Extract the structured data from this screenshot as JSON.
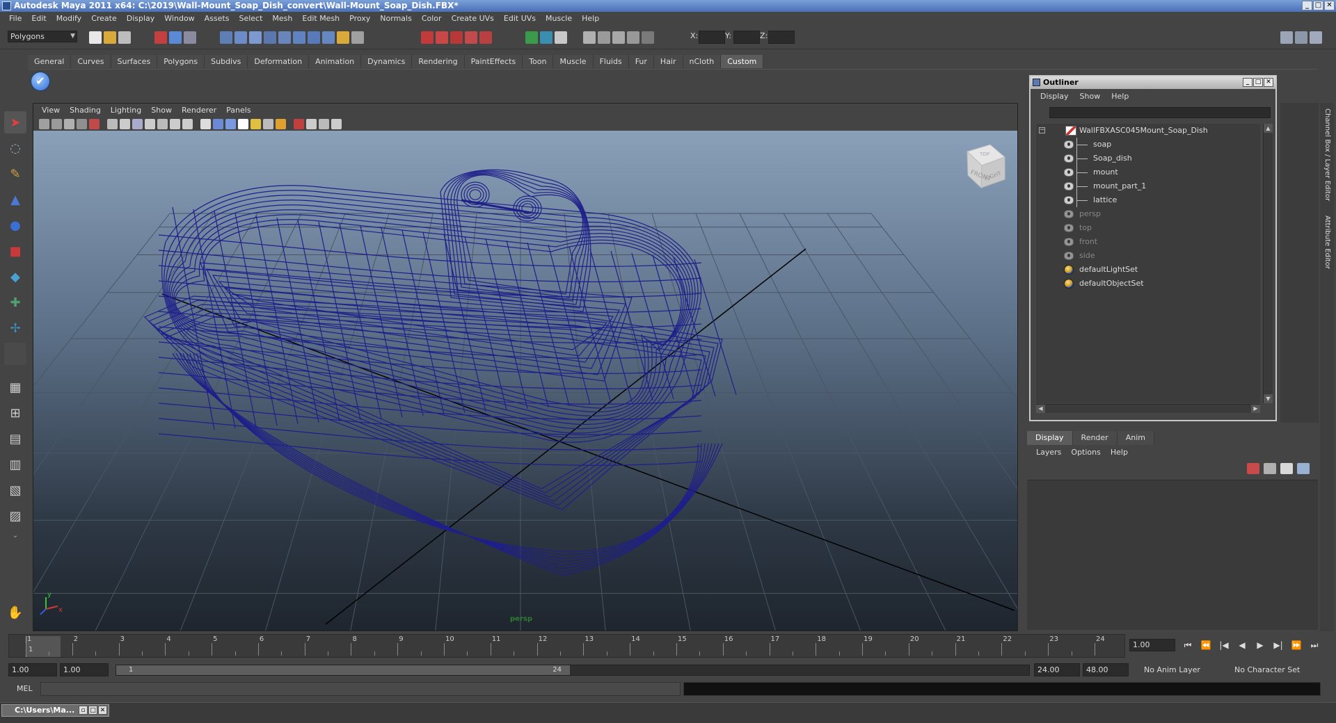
{
  "window": {
    "title": "Autodesk Maya 2011 x64: C:\\2019\\Wall-Mount_Soap_Dish_convert\\Wall-Mount_Soap_Dish.FBX*"
  },
  "menubar": [
    "File",
    "Edit",
    "Modify",
    "Create",
    "Display",
    "Window",
    "Assets",
    "Select",
    "Mesh",
    "Edit Mesh",
    "Proxy",
    "Normals",
    "Color",
    "Create UVs",
    "Edit UVs",
    "Muscle",
    "Help"
  ],
  "statusline": {
    "mode": "Polygons",
    "x_label": "X:",
    "y_label": "Y:",
    "z_label": "Z:"
  },
  "shelf": {
    "tabs": [
      "General",
      "Curves",
      "Surfaces",
      "Polygons",
      "Subdivs",
      "Deformation",
      "Animation",
      "Dynamics",
      "Rendering",
      "PaintEffects",
      "Toon",
      "Muscle",
      "Fluids",
      "Fur",
      "Hair",
      "nCloth",
      "Custom"
    ],
    "active": "Custom"
  },
  "viewport": {
    "menu": [
      "View",
      "Shading",
      "Lighting",
      "Show",
      "Renderer",
      "Panels"
    ],
    "camera_label": "persp",
    "viewcube": {
      "front": "FRONT",
      "right": "RIGHT",
      "top": "TOP"
    },
    "axis_x": "x",
    "axis_y": "y"
  },
  "outliner": {
    "title": "Outliner",
    "menu": [
      "Display",
      "Show",
      "Help"
    ],
    "items": [
      {
        "label": "WallFBXASC045Mount_Soap_Dish",
        "kind": "group",
        "dim": false
      },
      {
        "label": "soap",
        "kind": "child",
        "dim": false
      },
      {
        "label": "Soap_dish",
        "kind": "child",
        "dim": false
      },
      {
        "label": "mount",
        "kind": "child",
        "dim": false
      },
      {
        "label": "mount_part_1",
        "kind": "child",
        "dim": false
      },
      {
        "label": "lattice",
        "kind": "child",
        "dim": false
      },
      {
        "label": "persp",
        "kind": "camera",
        "dim": true
      },
      {
        "label": "top",
        "kind": "camera",
        "dim": true
      },
      {
        "label": "front",
        "kind": "camera",
        "dim": true
      },
      {
        "label": "side",
        "kind": "camera",
        "dim": true
      },
      {
        "label": "defaultLightSet",
        "kind": "set",
        "dim": false
      },
      {
        "label": "defaultObjectSet",
        "kind": "set",
        "dim": false
      }
    ]
  },
  "side_tabs": [
    "Channel Box / Layer Editor",
    "Attribute Editor"
  ],
  "layer_editor": {
    "tabs": [
      "Display",
      "Render",
      "Anim"
    ],
    "active": "Display",
    "menu": [
      "Layers",
      "Options",
      "Help"
    ]
  },
  "timeline": {
    "ticks": [
      "1",
      "2",
      "3",
      "4",
      "5",
      "6",
      "7",
      "8",
      "9",
      "10",
      "11",
      "12",
      "13",
      "14",
      "15",
      "16",
      "17",
      "18",
      "19",
      "20",
      "21",
      "22",
      "23",
      "24"
    ],
    "current_frame_marker": "1",
    "current_frame": "1.00"
  },
  "range": {
    "start": "1.00",
    "playback_start": "1.00",
    "handle_start": "1",
    "handle_end": "24",
    "playback_end": "24.00",
    "end": "48.00",
    "anim_layer": "No Anim Layer",
    "character_set": "No Character Set"
  },
  "command_line": {
    "label": "MEL"
  },
  "taskbar": {
    "label": "C:\\Users\\Ma..."
  },
  "colors": {
    "wireframe": "#1f1f8a",
    "accent": "#4a70b8"
  }
}
